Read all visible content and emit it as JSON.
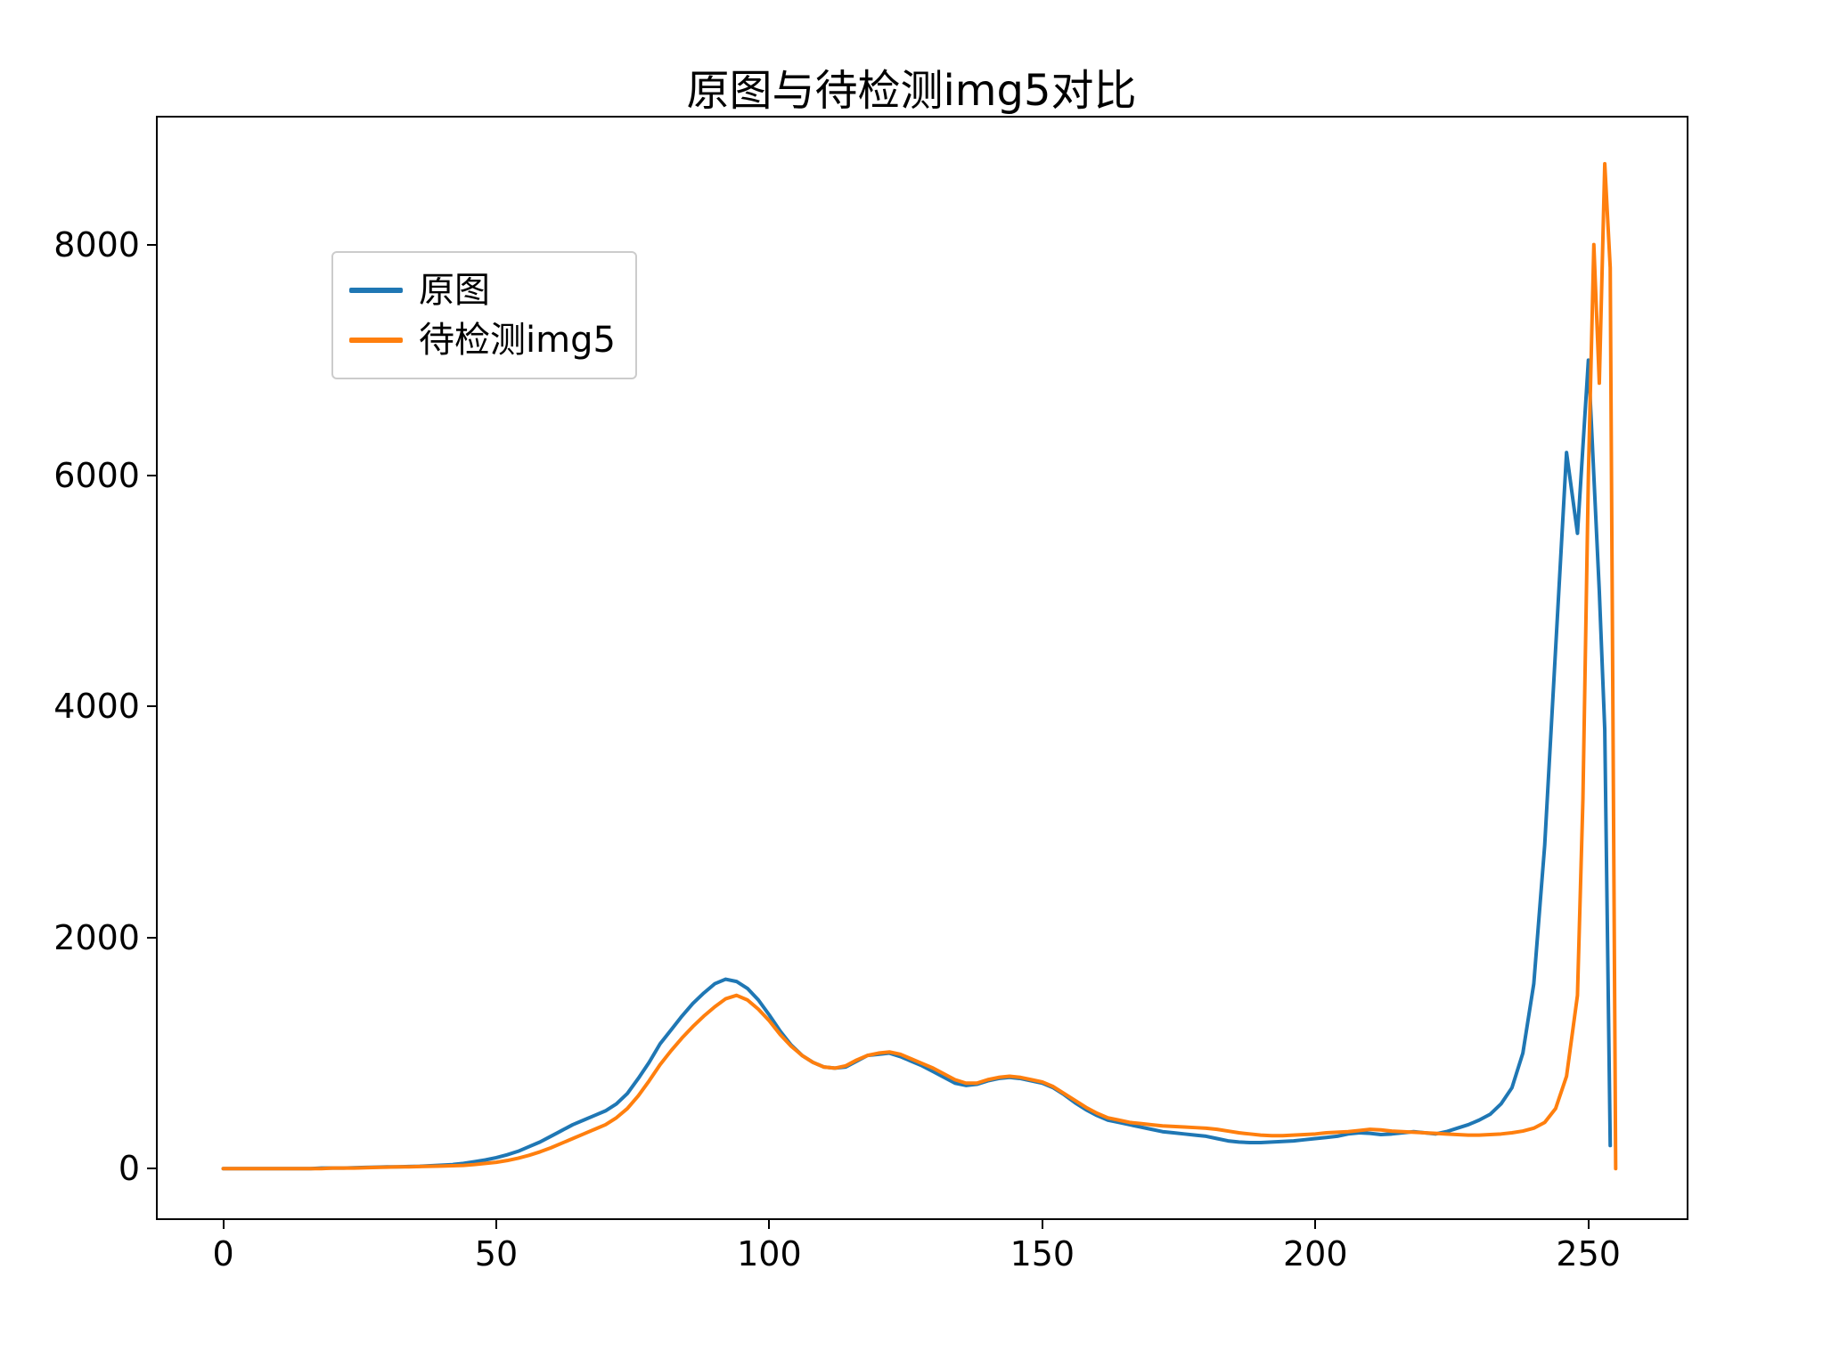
{
  "chart_data": {
    "type": "line",
    "title": "原图与待检测img5对比",
    "xlabel": "",
    "ylabel": "",
    "xlim": [
      -12,
      268
    ],
    "ylim": [
      -430,
      9100
    ],
    "xticks": [
      0,
      50,
      100,
      150,
      200,
      250
    ],
    "yticks": [
      0,
      2000,
      4000,
      6000,
      8000
    ],
    "legend_position": "upper left",
    "colors": {
      "s1": "#1f77b4",
      "s2": "#ff7f0e"
    },
    "series": [
      {
        "name": "原图",
        "color": "#1f77b4",
        "x": [
          0,
          2,
          4,
          6,
          8,
          10,
          12,
          14,
          16,
          18,
          20,
          22,
          24,
          26,
          28,
          30,
          32,
          34,
          36,
          38,
          40,
          42,
          44,
          46,
          48,
          50,
          52,
          54,
          56,
          58,
          60,
          62,
          64,
          66,
          68,
          70,
          72,
          74,
          76,
          78,
          80,
          82,
          84,
          86,
          88,
          90,
          92,
          94,
          96,
          98,
          100,
          102,
          104,
          106,
          108,
          110,
          112,
          114,
          116,
          118,
          120,
          122,
          124,
          126,
          128,
          130,
          132,
          134,
          136,
          138,
          140,
          142,
          144,
          146,
          148,
          150,
          152,
          154,
          156,
          158,
          160,
          162,
          164,
          166,
          168,
          170,
          172,
          174,
          176,
          178,
          180,
          182,
          184,
          186,
          188,
          190,
          192,
          194,
          196,
          198,
          200,
          202,
          204,
          206,
          208,
          210,
          212,
          214,
          216,
          218,
          220,
          222,
          224,
          226,
          228,
          230,
          232,
          234,
          236,
          238,
          240,
          242,
          244,
          246,
          248,
          250,
          251,
          252,
          253,
          254,
          255
        ],
        "y": [
          0,
          0,
          0,
          0,
          0,
          0,
          0,
          0,
          0,
          5,
          5,
          5,
          8,
          10,
          12,
          15,
          15,
          18,
          20,
          25,
          30,
          35,
          45,
          60,
          75,
          95,
          120,
          150,
          190,
          230,
          280,
          330,
          380,
          420,
          460,
          500,
          560,
          650,
          780,
          920,
          1080,
          1200,
          1320,
          1430,
          1520,
          1600,
          1640,
          1620,
          1560,
          1460,
          1330,
          1190,
          1070,
          980,
          920,
          880,
          870,
          880,
          930,
          980,
          990,
          1000,
          970,
          930,
          890,
          840,
          790,
          740,
          720,
          730,
          760,
          780,
          790,
          780,
          760,
          740,
          700,
          640,
          570,
          510,
          460,
          420,
          400,
          380,
          360,
          340,
          320,
          310,
          300,
          290,
          280,
          260,
          240,
          230,
          225,
          225,
          230,
          235,
          240,
          250,
          260,
          270,
          280,
          300,
          310,
          305,
          295,
          300,
          310,
          320,
          310,
          300,
          320,
          350,
          380,
          420,
          470,
          560,
          700,
          1000,
          1600,
          2800,
          4500,
          6200,
          5500,
          7000,
          6000,
          5000,
          3800,
          200
        ]
      },
      {
        "name": "待检测img5",
        "color": "#ff7f0e",
        "x": [
          0,
          2,
          4,
          6,
          8,
          10,
          12,
          14,
          16,
          18,
          20,
          22,
          24,
          26,
          28,
          30,
          32,
          34,
          36,
          38,
          40,
          42,
          44,
          46,
          48,
          50,
          52,
          54,
          56,
          58,
          60,
          62,
          64,
          66,
          68,
          70,
          72,
          74,
          76,
          78,
          80,
          82,
          84,
          86,
          88,
          90,
          92,
          94,
          96,
          98,
          100,
          102,
          104,
          106,
          108,
          110,
          112,
          114,
          116,
          118,
          120,
          122,
          124,
          126,
          128,
          130,
          132,
          134,
          136,
          138,
          140,
          142,
          144,
          146,
          148,
          150,
          152,
          154,
          156,
          158,
          160,
          162,
          164,
          166,
          168,
          170,
          172,
          174,
          176,
          178,
          180,
          182,
          184,
          186,
          188,
          190,
          192,
          194,
          196,
          198,
          200,
          202,
          204,
          206,
          208,
          210,
          212,
          214,
          216,
          218,
          220,
          222,
          224,
          226,
          228,
          230,
          232,
          234,
          236,
          238,
          240,
          242,
          244,
          246,
          248,
          249,
          250,
          251,
          252,
          253,
          254,
          255
        ],
        "y": [
          0,
          0,
          0,
          0,
          0,
          0,
          0,
          0,
          0,
          0,
          5,
          5,
          5,
          8,
          10,
          12,
          15,
          15,
          18,
          20,
          22,
          25,
          28,
          35,
          45,
          55,
          70,
          90,
          115,
          145,
          180,
          220,
          260,
          300,
          340,
          380,
          440,
          520,
          630,
          760,
          900,
          1020,
          1130,
          1230,
          1320,
          1400,
          1470,
          1500,
          1460,
          1380,
          1280,
          1160,
          1060,
          980,
          920,
          880,
          870,
          890,
          940,
          980,
          1000,
          1010,
          990,
          950,
          910,
          870,
          820,
          770,
          740,
          740,
          770,
          790,
          800,
          790,
          770,
          750,
          710,
          650,
          590,
          530,
          480,
          440,
          420,
          400,
          390,
          380,
          370,
          365,
          360,
          355,
          350,
          340,
          325,
          310,
          300,
          290,
          285,
          285,
          290,
          295,
          300,
          310,
          315,
          320,
          330,
          340,
          335,
          325,
          320,
          315,
          310,
          305,
          300,
          295,
          290,
          290,
          295,
          300,
          310,
          325,
          350,
          400,
          520,
          800,
          1500,
          3200,
          6000,
          8000,
          6800,
          8700,
          7800,
          0
        ]
      }
    ]
  }
}
